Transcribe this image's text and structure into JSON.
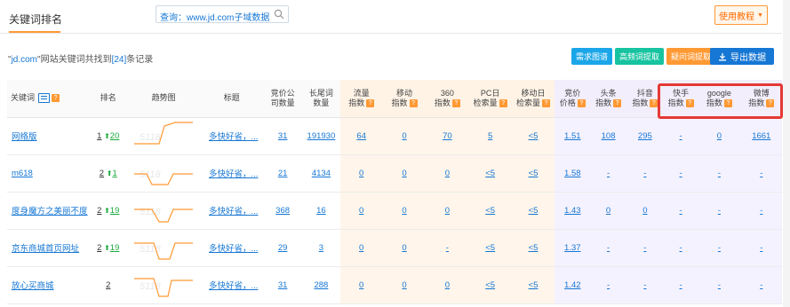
{
  "tab": {
    "label": "关键词排名"
  },
  "search": {
    "label": "查询：",
    "value": "www.jd.com子域数据"
  },
  "tutorial": {
    "label": "使用教程"
  },
  "summary": {
    "prefix": "\"",
    "domain": "jd.com",
    "middle": "\"网站关键词共找到",
    "count": "[24]",
    "suffix": "条记录"
  },
  "actions": [
    {
      "label": "需求图谱",
      "color": "blue"
    },
    {
      "label": "高频词提取",
      "color": "green"
    },
    {
      "label": "疑问词提取",
      "color": "orange"
    }
  ],
  "export": {
    "label": "导出数据"
  },
  "headers": {
    "keyword": "关键词",
    "rank": "排名",
    "trend": "趋势图",
    "title": "标题",
    "bid_count": [
      "竞价公",
      "司数量"
    ],
    "longtail": [
      "长尾词",
      "数量"
    ],
    "traffic": [
      "流量",
      "指数"
    ],
    "mobile": [
      "移动",
      "指数"
    ],
    "idx360": [
      "360",
      "指数"
    ],
    "pc_daily": [
      "PC日",
      "检索量"
    ],
    "mobile_daily": [
      "移动日",
      "检索量"
    ],
    "bid_price": [
      "竞价",
      "价格"
    ],
    "toutiao": [
      "头条",
      "指数"
    ],
    "douyin": [
      "抖音",
      "指数"
    ],
    "kuaishou": [
      "快手",
      "指数"
    ],
    "google": [
      "google",
      "指数"
    ],
    "weibo": [
      "微博",
      "指数"
    ]
  },
  "rows": [
    {
      "keyword": "网络版",
      "rank": "1",
      "change": "20",
      "title": "多快好省，...",
      "bid_count": "31",
      "longtail": "191930",
      "traffic": "64",
      "mobile": "0",
      "idx360": "70",
      "pc_daily": "5",
      "mobile_daily": "<5",
      "bid_price": "1.51",
      "toutiao": "108",
      "douyin": "295",
      "kuaishou": "-",
      "google": "0",
      "weibo": "1661"
    },
    {
      "keyword": "m618",
      "rank": "2",
      "change": "1",
      "title": "多快好省，...",
      "bid_count": "21",
      "longtail": "4134",
      "traffic": "0",
      "mobile": "0",
      "idx360": "0",
      "pc_daily": "<5",
      "mobile_daily": "<5",
      "bid_price": "1.58",
      "toutiao": "-",
      "douyin": "-",
      "kuaishou": "-",
      "google": "-",
      "weibo": "-"
    },
    {
      "keyword": "度身魔方之美丽不度",
      "rank": "2",
      "change": "19",
      "title": "多快好省，...",
      "bid_count": "368",
      "longtail": "16",
      "traffic": "0",
      "mobile": "0",
      "idx360": "0",
      "pc_daily": "<5",
      "mobile_daily": "<5",
      "bid_price": "1.43",
      "toutiao": "0",
      "douyin": "0",
      "kuaishou": "-",
      "google": "-",
      "weibo": "-"
    },
    {
      "keyword": "京东商城首页网址",
      "rank": "2",
      "change": "19",
      "title": "多快好省，...",
      "bid_count": "29",
      "longtail": "3",
      "traffic": "0",
      "mobile": "0",
      "idx360": "-",
      "pc_daily": "<5",
      "mobile_daily": "<5",
      "bid_price": "1.37",
      "toutiao": "-",
      "douyin": "-",
      "kuaishou": "-",
      "google": "-",
      "weibo": "-"
    },
    {
      "keyword": "放心买商城",
      "rank": "2",
      "change": "",
      "title": "多快好省，...",
      "bid_count": "31",
      "longtail": "288",
      "traffic": "0",
      "mobile": "0",
      "idx360": "0",
      "pc_daily": "<5",
      "mobile_daily": "<5",
      "bid_price": "1.42",
      "toutiao": "-",
      "douyin": "-",
      "kuaishou": "-",
      "google": "-",
      "weibo": "-"
    }
  ],
  "colors": {
    "accent_orange": "#ff9933",
    "link_blue": "#1677d4",
    "highlight_red": "#e53935",
    "rank_up_green": "#19a93b"
  }
}
